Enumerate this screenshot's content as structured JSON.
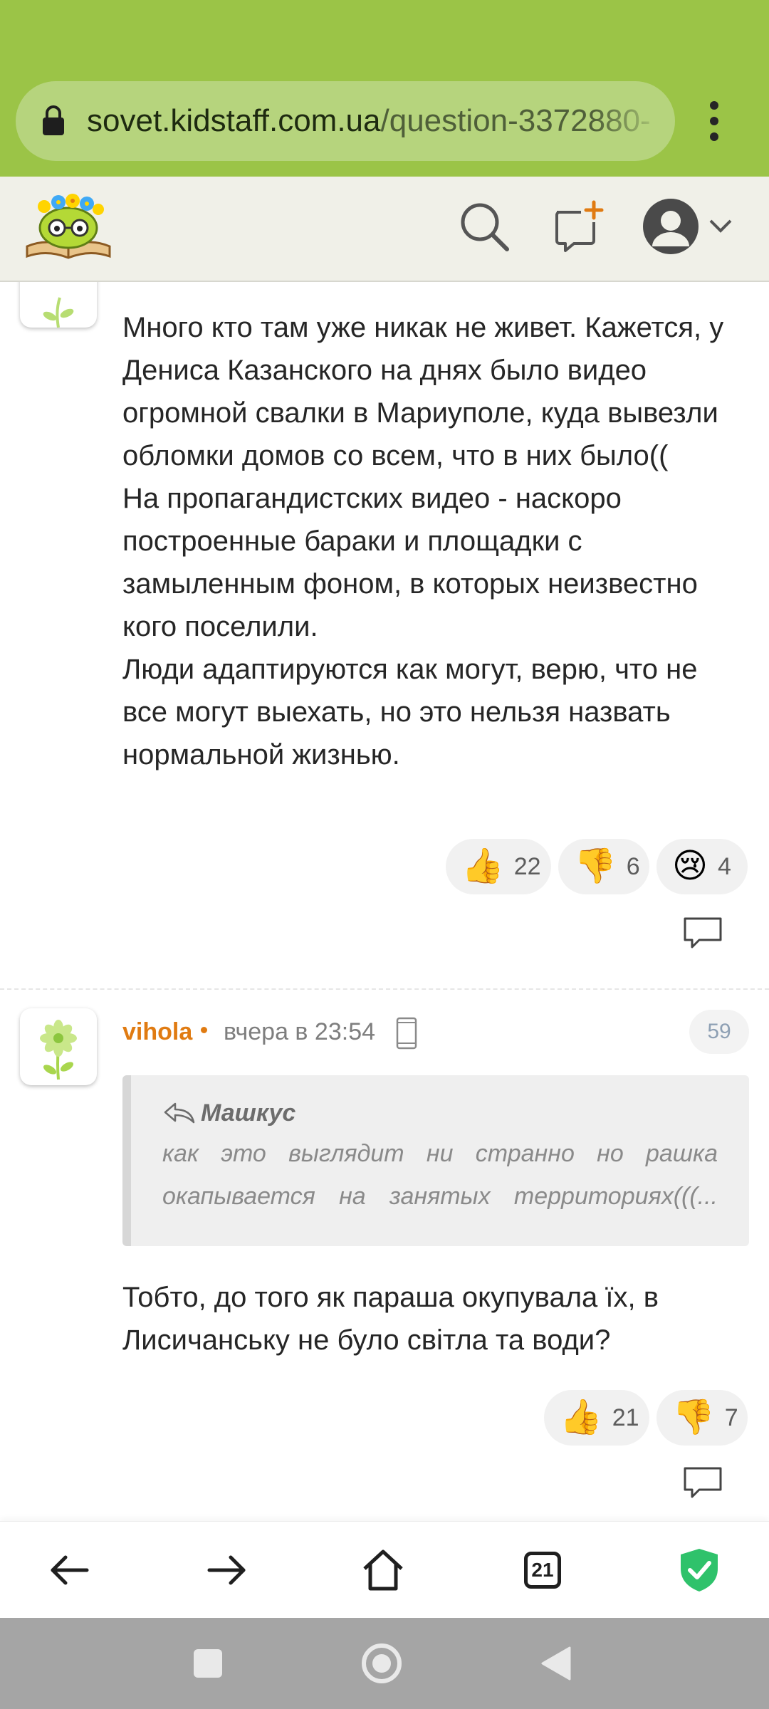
{
  "browser": {
    "url_domain": "sovet.kidstaff.com.ua",
    "url_path": "/question-3372880-",
    "tabs_count": "21"
  },
  "header": {
    "icons": [
      "logo-icon",
      "search-icon",
      "new-question-icon",
      "user-avatar-icon",
      "chevron-down-icon"
    ]
  },
  "post1": {
    "lines": [
      "Много кто там уже никак не живет. Кажется, у Дениса Казанского на днях было видео огромной свалки в Мариуполе, куда вывезли обломки домов со всем, что в них было((",
      "На пропагандистских видео - наскоро построенные бараки и площадки с замыленным фоном, в которых неизвестно кого поселили.",
      "Люди адаптируются как могут, верю, что не все могут выехать, но это нельзя назвать нормальной жизнью."
    ],
    "reactions": {
      "like": "22",
      "dislike": "6",
      "sad": "4"
    }
  },
  "post2": {
    "author": "vihola",
    "time": "вчера в 23:54",
    "number": "59",
    "quote_author": "Машкус",
    "quote_text": "как это выглядит ни странно но рашка окапывается на занятых территориях(((...",
    "text": "Тобто, до того як параша окупувала їх, в Лисичанську не було світла та води?",
    "reactions": {
      "like": "21",
      "dislike": "7"
    }
  },
  "colors": {
    "browser_green": "#9bc447",
    "author_orange": "#e07b12",
    "shield_green": "#2fc26b"
  }
}
